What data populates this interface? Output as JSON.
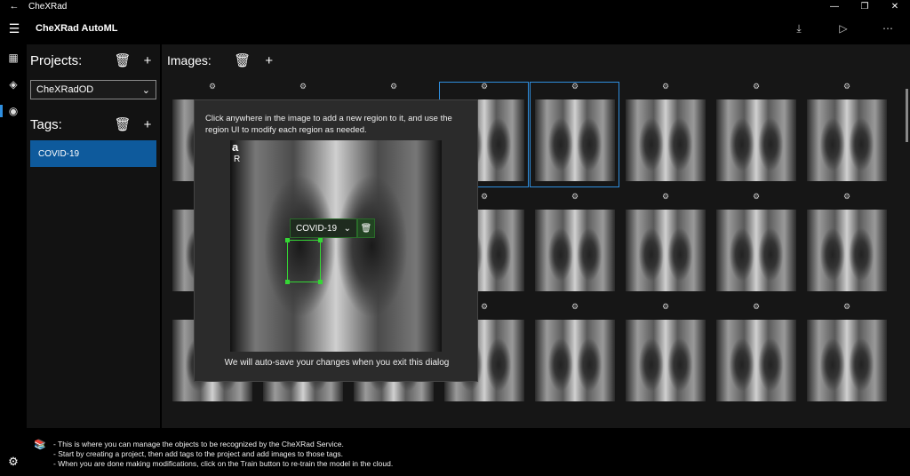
{
  "window": {
    "title": "CheXRad",
    "back_icon": "←",
    "minimize": "—",
    "restore": "❐",
    "close": "✕"
  },
  "appbar": {
    "menu_icon": "☰",
    "title": "CheXRad AutoML",
    "download_icon": "⤓",
    "play_icon": "▷",
    "more_icon": "⋯"
  },
  "rail": {
    "item1": "▦",
    "item2": "◈",
    "item3": "◉",
    "settings": "⚙"
  },
  "projects": {
    "heading": "Projects:",
    "delete_icon": "🗑",
    "add_icon": "+",
    "selected": "CheXRadOD",
    "chevron": "⌄"
  },
  "tags": {
    "heading": "Tags:",
    "delete_icon": "🗑",
    "add_icon": "+",
    "items": [
      "COVID-19"
    ]
  },
  "images": {
    "heading": "Images:",
    "delete_icon": "🗑",
    "add_icon": "+",
    "gear": "⚙"
  },
  "dialog": {
    "instructions": "Click anywhere in the image to add a new region to it, and use the region UI to modify each region as needed.",
    "image_label_a": "a",
    "image_label_r": "R",
    "region_tag": "COVID-19",
    "region_chevron": "⌄",
    "region_delete": "🗑",
    "footer": "We will auto-save your changes when you exit this dialog"
  },
  "help": {
    "icon": "📚",
    "line1": "- This is where you can manage the objects to be recognized by the CheXRad Service.",
    "line2": "- Start by creating a project, then add tags to the project and add images to those tags.",
    "line3": "- When you are done making modifications, click on the Train button to re-train the model in the cloud."
  }
}
